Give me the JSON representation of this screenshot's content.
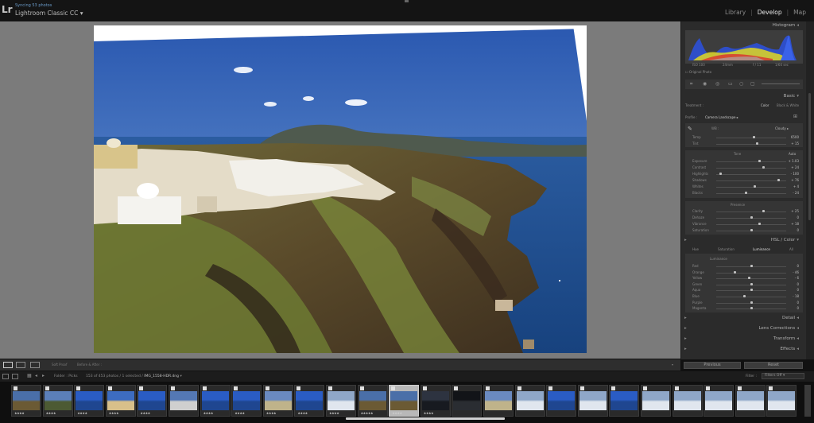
{
  "app": {
    "subtitle": "Syncing 53 photos",
    "title": "Lightroom Classic CC",
    "title_caret": "▾",
    "logo": "Lr"
  },
  "modules": [
    "Library",
    "Develop",
    "Map"
  ],
  "active_module": "Develop",
  "panel": {
    "histogram_label": "Histogram",
    "histogram_stats": [
      "ISO 100",
      "24mm",
      "f / 11",
      "1/60 sec"
    ],
    "original_photo_label": "Original Photo",
    "basic_label": "Basic",
    "treatment_label": "Treatment :",
    "treatment_options": [
      "Color",
      "Black & White"
    ],
    "profile_label": "Profile :",
    "profile_value": "Camera Landscape",
    "wb_label": "WB :",
    "wb_value": "Cloudy",
    "temp_label": "Temp",
    "temp_value": "6500",
    "tint_label": "Tint",
    "tint_value": "+ 15",
    "tone_label": "Tone",
    "auto_label": "Auto",
    "tone_rows": [
      {
        "label": "Exposure",
        "value": "+ 1.03",
        "level": 0.62
      },
      {
        "label": "Contrast",
        "value": "+ 24",
        "level": 0.68
      },
      {
        "label": "Highlights",
        "value": "- 100",
        "level": 0.05
      },
      {
        "label": "Shadows",
        "value": "+ 76",
        "level": 0.9
      },
      {
        "label": "Whites",
        "value": "+ 4",
        "level": 0.55
      },
      {
        "label": "Blacks",
        "value": "- 24",
        "level": 0.42
      }
    ],
    "presence_label": "Presence",
    "presence_rows": [
      {
        "label": "Clarity",
        "value": "+ 25",
        "level": 0.68
      },
      {
        "label": "Dehaze",
        "value": "0",
        "level": 0.5
      },
      {
        "label": "Vibrance",
        "value": "+ 18",
        "level": 0.62
      },
      {
        "label": "Saturation",
        "value": "0",
        "level": 0.5
      }
    ],
    "hsl_label": "HSL / Color",
    "hsl_tabs": [
      "Hue",
      "Saturation",
      "Luminance",
      "All"
    ],
    "luminance_label": "Luminance",
    "lum_rows": [
      {
        "label": "Red",
        "value": "0",
        "level": 0.5
      },
      {
        "label": "Orange",
        "value": "- 46",
        "level": 0.25
      },
      {
        "label": "Yellow",
        "value": "- 6",
        "level": 0.46
      },
      {
        "label": "Green",
        "value": "0",
        "level": 0.5
      },
      {
        "label": "Aqua",
        "value": "0",
        "level": 0.5
      },
      {
        "label": "Blue",
        "value": "- 18",
        "level": 0.4
      },
      {
        "label": "Purple",
        "value": "0",
        "level": 0.5
      },
      {
        "label": "Magenta",
        "value": "0",
        "level": 0.5
      }
    ],
    "detail_label": "Detail",
    "lens_label": "Lens Corrections",
    "transform_label": "Transform",
    "effects_label": "Effects",
    "previous_label": "Previous",
    "reset_label": "Reset"
  },
  "toolbar": {
    "soft_proof_label": "Soft Proof",
    "before_after_label": "Before & After :"
  },
  "filmstrip_header": {
    "folder_label": "Folder : Picks",
    "count_text": "153 of 453 photos / 1 selected /",
    "filename": "IMG_1558-HDR.dng",
    "filter_label": "Filter :",
    "filter_value": "Filters Off"
  },
  "colors": {
    "sky": "#2f62b8",
    "sea": "#1d4e8e",
    "accent_active": "#e8e8e8"
  },
  "filmstrip": {
    "thumbs": [
      {
        "kind": "landscape",
        "stars": "★★★★"
      },
      {
        "kind": "cliff",
        "stars": "★★★★"
      },
      {
        "kind": "blue",
        "stars": "★★★★"
      },
      {
        "kind": "dome",
        "stars": "★★★★"
      },
      {
        "kind": "blue",
        "stars": "★★★★"
      },
      {
        "kind": "tower",
        "stars": ""
      },
      {
        "kind": "blue",
        "stars": "★★★★"
      },
      {
        "kind": "blue",
        "stars": "★★★★"
      },
      {
        "kind": "village",
        "stars": "★★★★"
      },
      {
        "kind": "blue",
        "stars": "★★★★"
      },
      {
        "kind": "snow",
        "stars": "★★★★"
      },
      {
        "kind": "landscape",
        "stars": "★★★★★"
      },
      {
        "kind": "landscape",
        "stars": "★★★★"
      },
      {
        "kind": "dark",
        "stars": "★★★★"
      },
      {
        "kind": "night",
        "stars": ""
      },
      {
        "kind": "village",
        "stars": ""
      },
      {
        "kind": "snow",
        "stars": ""
      },
      {
        "kind": "blue",
        "stars": ""
      },
      {
        "kind": "snow",
        "stars": ""
      },
      {
        "kind": "blue",
        "stars": ""
      },
      {
        "kind": "snow",
        "stars": ""
      },
      {
        "kind": "snow",
        "stars": ""
      },
      {
        "kind": "snow",
        "stars": ""
      },
      {
        "kind": "snow",
        "stars": ""
      },
      {
        "kind": "snow",
        "stars": ""
      }
    ],
    "selected_index": 12
  }
}
